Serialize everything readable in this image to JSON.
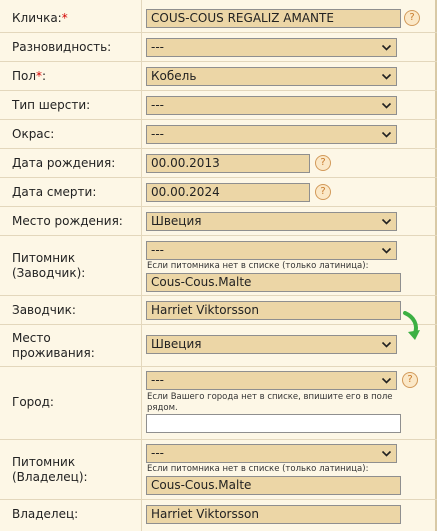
{
  "labels": {
    "name": "Кличка:",
    "variety": "Разновидность:",
    "sex": "Пол",
    "coat_type": "Тип шерсти:",
    "color": "Окрас:",
    "birth_date": "Дата рождения:",
    "death_date": "Дата смерти:",
    "birth_place": "Место рождения:",
    "kennel_breeder_1": "Питомник",
    "kennel_breeder_2": "(Заводчик):",
    "breeder": "Заводчик:",
    "residence_1": "Место",
    "residence_2": "проживания:",
    "city": "Город:",
    "kennel_owner_1": "Питомник",
    "kennel_owner_2": "(Владелец):",
    "owner": "Владелец:",
    "required_mark": "*",
    "sex_suffix": ":"
  },
  "values": {
    "name": "COUS-COUS REGALIZ AMANTE",
    "variety": "---",
    "sex": "Кобель",
    "coat_type": "---",
    "color": "---",
    "birth_date": "00.00.2013",
    "death_date": "00.00.2024",
    "birth_place": "Швеция",
    "kennel_breeder_select": "---",
    "kennel_breeder_input": "Cous-Cous.Malte",
    "breeder": "Harriet Viktorsson",
    "residence": "Швеция",
    "city_select": "---",
    "city_input": "",
    "kennel_owner_select": "---",
    "kennel_owner_input": "Cous-Cous.Malte",
    "owner": "Harriet Viktorsson"
  },
  "hints": {
    "kennel_breeder": "Если питомника нет в списке (только латиница):",
    "city_1": "Если Вашего города нет в списке, впишите его в поле",
    "city_2": "рядом.",
    "kennel_owner": "Если питомника нет в списке (только латиница):"
  },
  "help_glyph": "?",
  "colors": {
    "field_bg": "#ecd6a6",
    "page_bg": "#fdf7e6",
    "required": "#d40000",
    "arrow": "#3cb043"
  },
  "icons": [
    "help-icon",
    "chevron-down-icon",
    "green-arrow-icon"
  ]
}
